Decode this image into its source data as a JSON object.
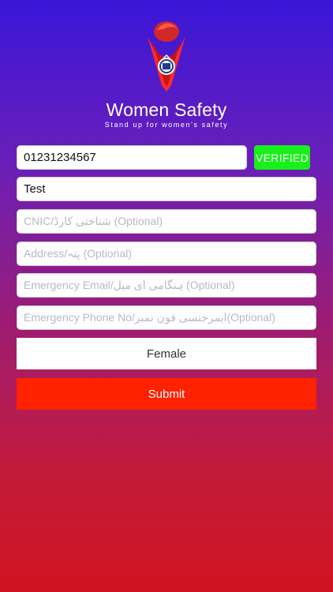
{
  "app": {
    "title": "Women Safety",
    "tagline": "Stand up for women's safety",
    "logo_icon": "women-safety-shield-pin"
  },
  "form": {
    "phone_value": "01231234567",
    "verified_label": "VERIFIED",
    "name_value": "Test",
    "cnic_placeholder": "CNIC/شناختی کارڈ (Optional)",
    "address_placeholder": "Address/پتہ (Optional)",
    "emergency_email_placeholder": "Emergency Email/ہنگامی ای میل (Optional)",
    "emergency_phone_placeholder": "Emergency Phone No/ایمرجنسی فون نمبر(Optional)",
    "gender_value": "Female",
    "submit_label": "Submit"
  },
  "colors": {
    "verified": "#18f01a",
    "submit": "#ff2200",
    "gradient_top": "#3a16d9",
    "gradient_bottom": "#cf1420"
  }
}
